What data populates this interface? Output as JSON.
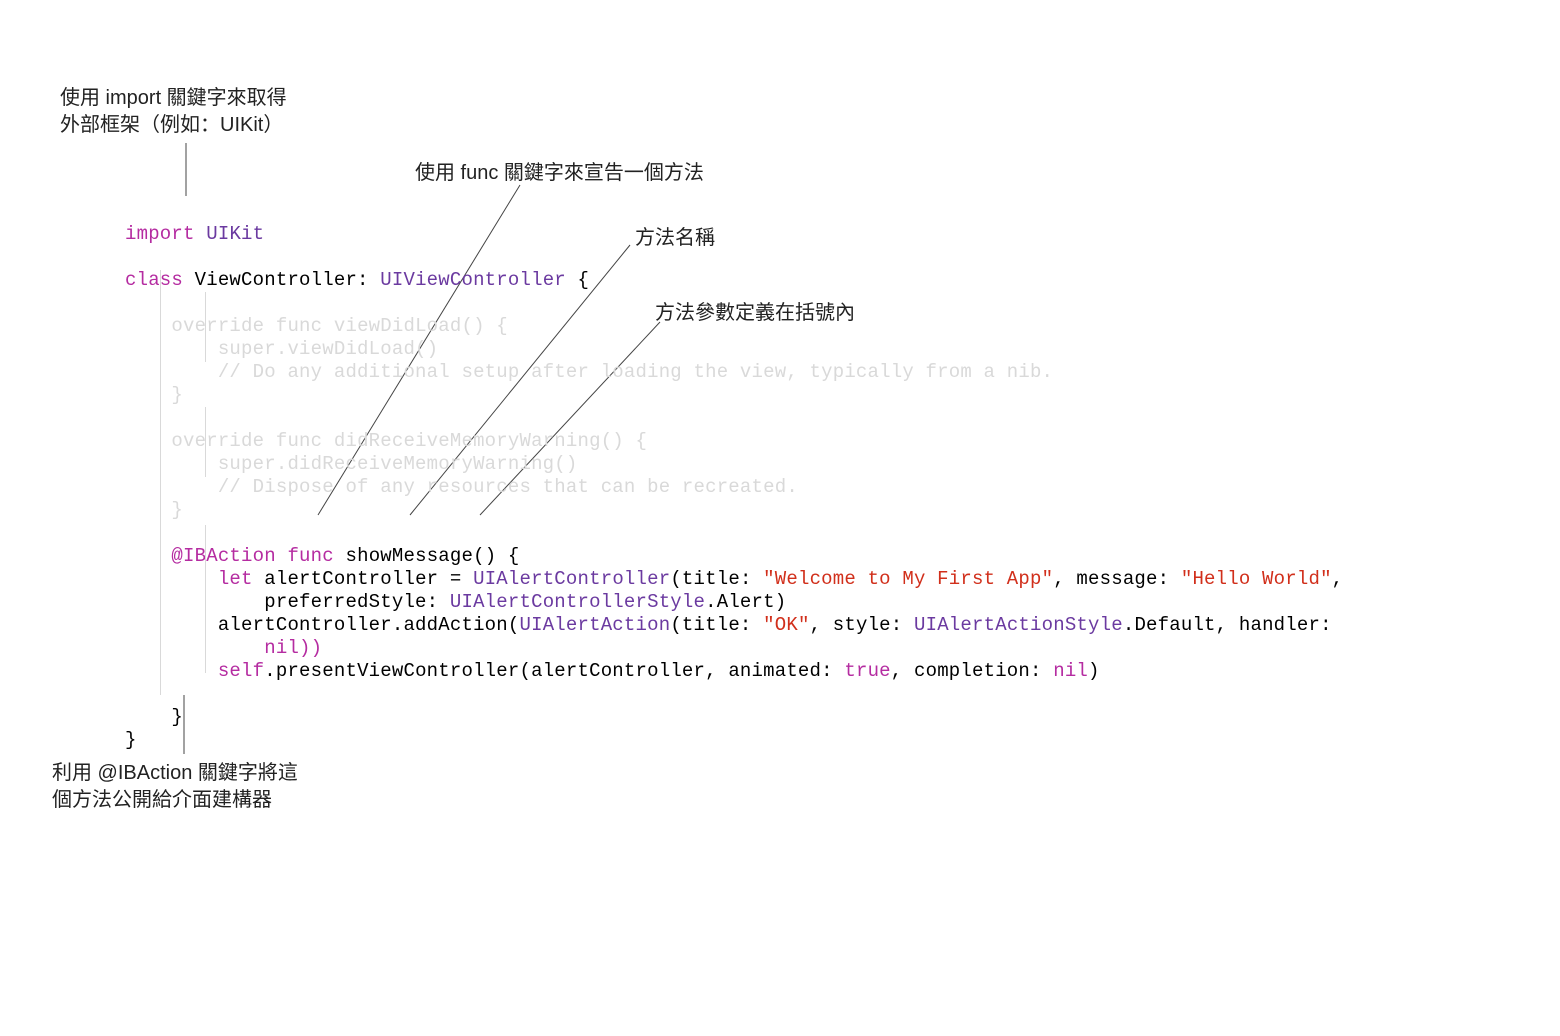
{
  "annotations": {
    "import_note_l1": "使用 import 關鍵字來取得",
    "import_note_l2": "外部框架（例如：UIKit）",
    "func_note": "使用 func 關鍵字來宣告一個方法",
    "method_name_note": "方法名稱",
    "params_note": "方法參數定義在括號內",
    "ibaction_note_l1": "利用 @IBAction 關鍵字將這",
    "ibaction_note_l2": "個方法公開給介面建構器"
  },
  "code": {
    "import_kw": "import",
    "uikit": "UIKit",
    "class_kw": "class",
    "vc": "ViewController:",
    "uivc": "UIViewController",
    "lbrace": "{",
    "override_func1": "override func",
    "viewDidLoad": "viewDidLoad() {",
    "super_vdl": "super.viewDidLoad()",
    "comment1": "// Do any additional setup after loading the view, typically from a nib.",
    "rbrace1": "}",
    "override_func2": "override func",
    "didReceive": "didReceiveMemoryWarning() {",
    "super_drm": "super.didReceiveMemoryWarning()",
    "comment2": "// Dispose of any resources that can be recreated.",
    "rbrace2": "}",
    "ibaction": "@IBAction",
    "func_kw": "func",
    "showMessage": "showMessage() {",
    "let_kw": "let",
    "alertCtrl": "alertController =",
    "uialert": "UIAlertController",
    "title_p": "(title:",
    "str_welcome": "\"Welcome to My First App\"",
    "msg_p": ", message:",
    "str_hello": "\"Hello World\"",
    "comma": ",",
    "prefStyle": "preferredStyle:",
    "uiacs": "UIAlertControllerStyle",
    "dot_alert": ".Alert)",
    "addAction_call": "alertController.addAction(",
    "uialertaction": "UIAlertAction",
    "title2": "(title:",
    "str_ok": "\"OK\"",
    "style_p": ", style:",
    "uiaas": "UIAlertActionStyle",
    "dot_default": ".Default, handler:",
    "nil_close": "nil))",
    "self_kw": "self",
    "present": ".presentViewController(alertController, animated:",
    "true_kw": "true",
    "completion": ", completion:",
    "nil2": "nil",
    "close_paren": ")",
    "rbrace3": "}",
    "rbrace4": "}"
  }
}
